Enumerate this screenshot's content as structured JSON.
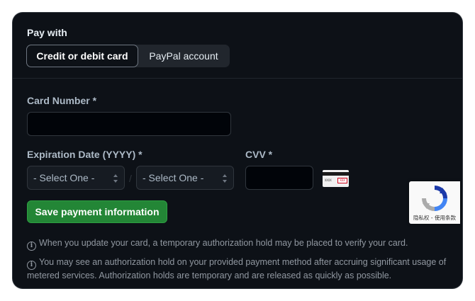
{
  "payment": {
    "heading": "Pay with",
    "tabs": [
      {
        "label": "Credit or debit card",
        "active": true
      },
      {
        "label": "PayPal account",
        "active": false
      }
    ],
    "card_number_label": "Card Number *",
    "card_number_value": "",
    "expiration_label": "Expiration Date (YYYY) *",
    "month_select": "- Select One -",
    "year_select": "- Select One -",
    "separator": "/",
    "cvv_label": "CVV *",
    "cvv_value": "",
    "cvv_icon": "cvv-card-icon",
    "cvv_icon_text_left": "XXXX",
    "cvv_icon_text_right": "XXX",
    "save_button": "Save payment information",
    "notes": [
      "When you update your card, a temporary authorization hold may be placed to verify your card.",
      "You may see an authorization hold on your provided payment method after accruing significant usage of metered services. Authorization holds are temporary and are released as quickly as possible."
    ]
  },
  "recaptcha": {
    "icon": "recaptcha-icon",
    "terms": "隐私权 - 使用条款"
  },
  "colors": {
    "background": "#0d1117",
    "accent_green": "#238636",
    "text": "#e6edf3",
    "muted": "#9198a1"
  }
}
